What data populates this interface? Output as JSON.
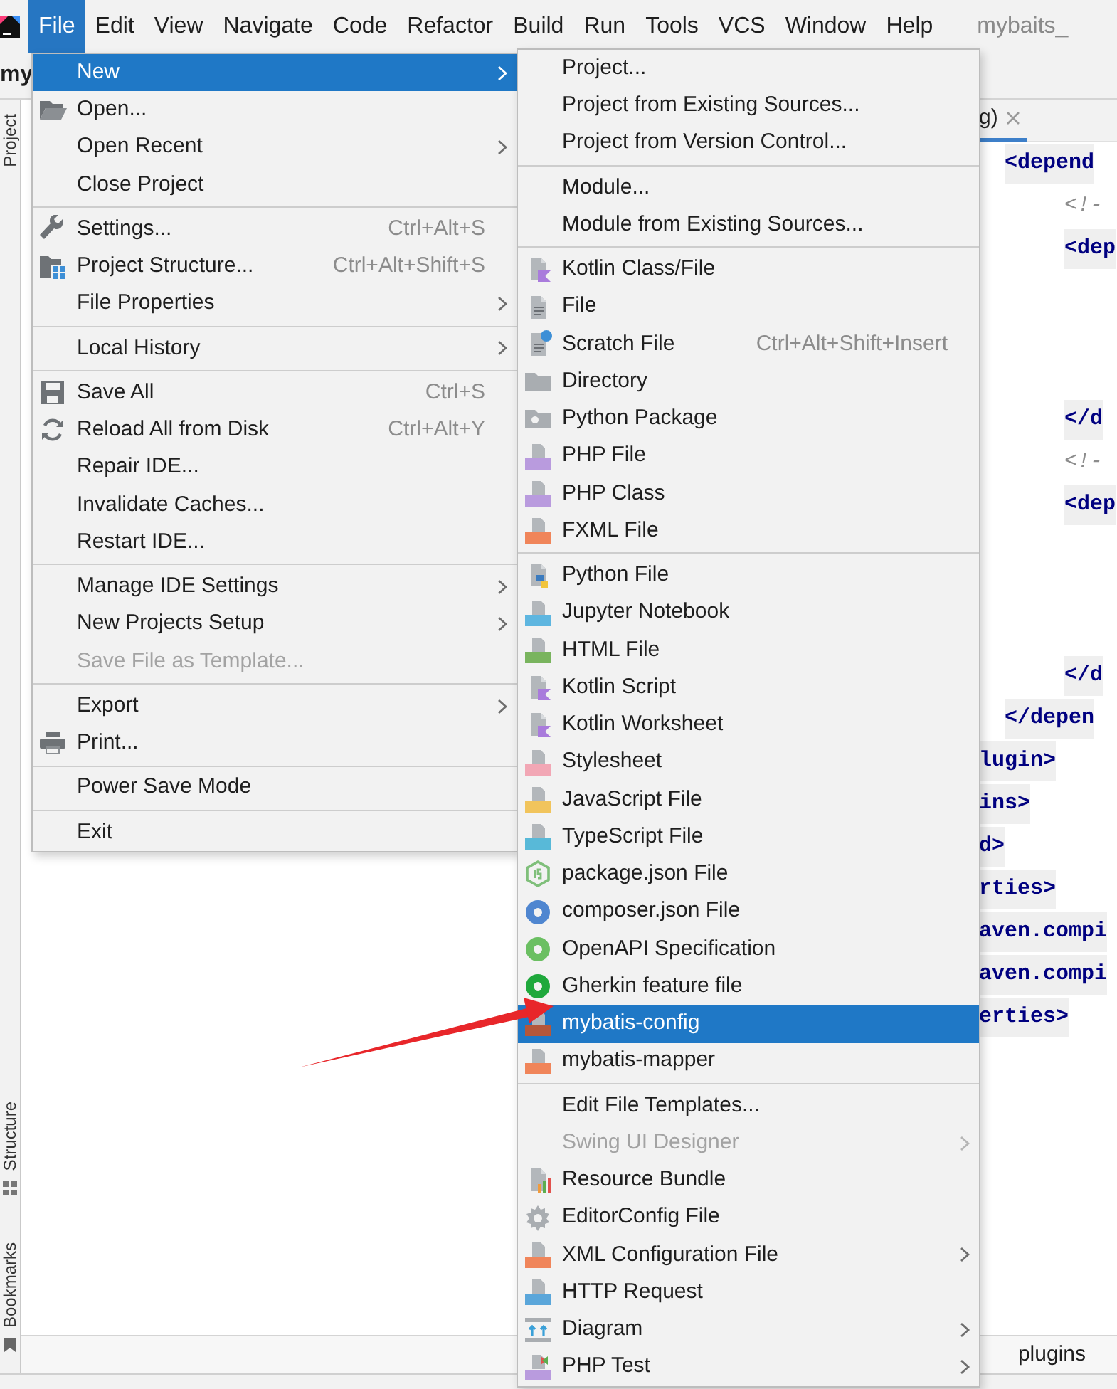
{
  "menu_bar": {
    "items": [
      {
        "label": "File",
        "selected": true
      },
      {
        "label": "Edit",
        "selected": false
      },
      {
        "label": "View",
        "selected": false
      },
      {
        "label": "Navigate",
        "selected": false
      },
      {
        "label": "Code",
        "selected": false
      },
      {
        "label": "Refactor",
        "selected": false
      },
      {
        "label": "Build",
        "selected": false
      },
      {
        "label": "Run",
        "selected": false
      },
      {
        "label": "Tools",
        "selected": false
      },
      {
        "label": "VCS",
        "selected": false
      },
      {
        "label": "Window",
        "selected": false
      },
      {
        "label": "Help",
        "selected": false
      }
    ],
    "title": "mybaits_"
  },
  "navigation_bar": {
    "project": "my"
  },
  "left_strip": {
    "top": [
      {
        "label": "Project"
      }
    ],
    "bottom": [
      {
        "label": "Structure"
      },
      {
        "label": "Bookmarks"
      }
    ]
  },
  "editor": {
    "tab": "g)",
    "lines": [
      {
        "kind": "outer",
        "text": "<depend"
      },
      {
        "kind": "comment",
        "text": "<!-"
      },
      {
        "kind": "inner",
        "text": "<dep"
      },
      {
        "kind": "blank"
      },
      {
        "kind": "blank"
      },
      {
        "kind": "blank"
      },
      {
        "kind": "inner",
        "text": "</d"
      },
      {
        "kind": "comment",
        "text": "<!-"
      },
      {
        "kind": "inner",
        "text": "<dep"
      },
      {
        "kind": "blank"
      },
      {
        "kind": "blank"
      },
      {
        "kind": "blank"
      },
      {
        "kind": "inner",
        "text": "</d"
      },
      {
        "kind": "outer",
        "text": "</depen"
      },
      {
        "kind": "cut",
        "text": "lugin>"
      },
      {
        "kind": "cut",
        "text": "ins>"
      },
      {
        "kind": "cut",
        "text": "d>"
      },
      {
        "kind": "cut",
        "text": "rties>"
      },
      {
        "kind": "cut",
        "text": "aven.compi"
      },
      {
        "kind": "cut",
        "text": "aven.compi"
      },
      {
        "kind": "cut",
        "text": "erties>"
      }
    ],
    "breadcrumb": "plugins"
  },
  "file_menu": {
    "items": [
      {
        "kind": "item",
        "label": "New",
        "selected": true,
        "disabled": false,
        "submenu": true
      },
      {
        "kind": "item",
        "label": "Open...",
        "selected": false,
        "disabled": false,
        "submenu": false
      },
      {
        "kind": "item",
        "label": "Open Recent",
        "selected": false,
        "disabled": false,
        "submenu": true
      },
      {
        "kind": "item",
        "label": "Close Project",
        "selected": false,
        "disabled": false,
        "submenu": false
      },
      {
        "kind": "separator"
      },
      {
        "kind": "item",
        "label": "Settings...",
        "shortcut": "Ctrl+Alt+S",
        "selected": false,
        "disabled": false,
        "submenu": false
      },
      {
        "kind": "item",
        "label": "Project Structure...",
        "shortcut": "Ctrl+Alt+Shift+S",
        "selected": false,
        "disabled": false,
        "submenu": false
      },
      {
        "kind": "item",
        "label": "File Properties",
        "selected": false,
        "disabled": false,
        "submenu": true
      },
      {
        "kind": "separator"
      },
      {
        "kind": "item",
        "label": "Local History",
        "selected": false,
        "disabled": false,
        "submenu": true
      },
      {
        "kind": "separator"
      },
      {
        "kind": "item",
        "label": "Save All",
        "shortcut": "Ctrl+S",
        "selected": false,
        "disabled": false,
        "submenu": false
      },
      {
        "kind": "item",
        "label": "Reload All from Disk",
        "shortcut": "Ctrl+Alt+Y",
        "selected": false,
        "disabled": false,
        "submenu": false
      },
      {
        "kind": "item",
        "label": "Repair IDE...",
        "selected": false,
        "disabled": false,
        "submenu": false
      },
      {
        "kind": "item",
        "label": "Invalidate Caches...",
        "selected": false,
        "disabled": false,
        "submenu": false
      },
      {
        "kind": "item",
        "label": "Restart IDE...",
        "selected": false,
        "disabled": false,
        "submenu": false
      },
      {
        "kind": "separator"
      },
      {
        "kind": "item",
        "label": "Manage IDE Settings",
        "selected": false,
        "disabled": false,
        "submenu": true
      },
      {
        "kind": "item",
        "label": "New Projects Setup",
        "selected": false,
        "disabled": false,
        "submenu": true
      },
      {
        "kind": "item",
        "label": "Save File as Template...",
        "selected": false,
        "disabled": true,
        "submenu": false
      },
      {
        "kind": "separator"
      },
      {
        "kind": "item",
        "label": "Export",
        "selected": false,
        "disabled": false,
        "submenu": true
      },
      {
        "kind": "item",
        "label": "Print...",
        "selected": false,
        "disabled": false,
        "submenu": false
      },
      {
        "kind": "separator"
      },
      {
        "kind": "item",
        "label": "Power Save Mode",
        "selected": false,
        "disabled": false,
        "submenu": false
      },
      {
        "kind": "separator"
      },
      {
        "kind": "item",
        "label": "Exit",
        "selected": false,
        "disabled": false,
        "submenu": false
      }
    ]
  },
  "new_menu": {
    "items": [
      {
        "kind": "item",
        "label": "Project...",
        "selected": false,
        "disabled": false,
        "submenu": false
      },
      {
        "kind": "item",
        "label": "Project from Existing Sources...",
        "selected": false,
        "disabled": false,
        "submenu": false
      },
      {
        "kind": "item",
        "label": "Project from Version Control...",
        "selected": false,
        "disabled": false,
        "submenu": false
      },
      {
        "kind": "separator"
      },
      {
        "kind": "item",
        "label": "Module...",
        "selected": false,
        "disabled": false,
        "submenu": false
      },
      {
        "kind": "item",
        "label": "Module from Existing Sources...",
        "selected": false,
        "disabled": false,
        "submenu": false
      },
      {
        "kind": "separator"
      },
      {
        "kind": "item",
        "label": "Kotlin Class/File",
        "color": "#a97bdc",
        "selected": false,
        "disabled": false,
        "submenu": false
      },
      {
        "kind": "item",
        "label": "File",
        "selected": false,
        "disabled": false,
        "submenu": false
      },
      {
        "kind": "item",
        "label": "Scratch File",
        "color": "#3d8fd6",
        "shortcut": "Ctrl+Alt+Shift+Insert",
        "selected": false,
        "disabled": false,
        "submenu": false
      },
      {
        "kind": "item",
        "label": "Directory",
        "selected": false,
        "disabled": false,
        "submenu": false
      },
      {
        "kind": "item",
        "label": "Python Package",
        "selected": false,
        "disabled": false,
        "submenu": false
      },
      {
        "kind": "item",
        "label": "PHP File",
        "color": "#b99bde",
        "selected": false,
        "disabled": false,
        "submenu": false
      },
      {
        "kind": "item",
        "label": "PHP Class",
        "color": "#b99bde",
        "selected": false,
        "disabled": false,
        "submenu": false
      },
      {
        "kind": "item",
        "label": "FXML File",
        "color": "#f0855a",
        "selected": false,
        "disabled": false,
        "submenu": false
      },
      {
        "kind": "separator"
      },
      {
        "kind": "item",
        "label": "Python File",
        "selected": false,
        "disabled": false,
        "submenu": false
      },
      {
        "kind": "item",
        "label": "Jupyter Notebook",
        "color": "#5eb6e0",
        "selected": false,
        "disabled": false,
        "submenu": false
      },
      {
        "kind": "item",
        "label": "HTML File",
        "color": "#79b45e",
        "selected": false,
        "disabled": false,
        "submenu": false
      },
      {
        "kind": "item",
        "label": "Kotlin Script",
        "color": "#a97bdc",
        "selected": false,
        "disabled": false,
        "submenu": false
      },
      {
        "kind": "item",
        "label": "Kotlin Worksheet",
        "color": "#a97bdc",
        "selected": false,
        "disabled": false,
        "submenu": false
      },
      {
        "kind": "item",
        "label": "Stylesheet",
        "color": "#f2a7b5",
        "selected": false,
        "disabled": false,
        "submenu": false
      },
      {
        "kind": "item",
        "label": "JavaScript File",
        "color": "#f1c45c",
        "selected": false,
        "disabled": false,
        "submenu": false
      },
      {
        "kind": "item",
        "label": "TypeScript File",
        "color": "#58b9d8",
        "selected": false,
        "disabled": false,
        "submenu": false
      },
      {
        "kind": "item",
        "label": "package.json File",
        "color": "#7fbf7a",
        "selected": false,
        "disabled": false,
        "submenu": false
      },
      {
        "kind": "item",
        "label": "composer.json File",
        "color": "#4f86d0",
        "selected": false,
        "disabled": false,
        "submenu": false
      },
      {
        "kind": "item",
        "label": "OpenAPI Specification",
        "color": "#6bbf62",
        "selected": false,
        "disabled": false,
        "submenu": false
      },
      {
        "kind": "item",
        "label": "Gherkin feature file",
        "color": "#1fa83c",
        "selected": false,
        "disabled": false,
        "submenu": false
      },
      {
        "kind": "item",
        "label": "mybatis-config",
        "color": "#b5573a",
        "selected": true,
        "disabled": false,
        "submenu": false
      },
      {
        "kind": "item",
        "label": "mybatis-mapper",
        "color": "#f0855a",
        "selected": false,
        "disabled": false,
        "submenu": false
      },
      {
        "kind": "separator"
      },
      {
        "kind": "item",
        "label": "Edit File Templates...",
        "selected": false,
        "disabled": false,
        "submenu": false
      },
      {
        "kind": "item",
        "label": "Swing UI Designer",
        "selected": false,
        "disabled": true,
        "submenu": true
      },
      {
        "kind": "item",
        "label": "Resource Bundle",
        "selected": false,
        "disabled": false,
        "submenu": false
      },
      {
        "kind": "item",
        "label": "EditorConfig File",
        "selected": false,
        "disabled": false,
        "submenu": false
      },
      {
        "kind": "item",
        "label": "XML Configuration File",
        "color": "#f0855a",
        "selected": false,
        "disabled": false,
        "submenu": true
      },
      {
        "kind": "item",
        "label": "HTTP Request",
        "color": "#5aa6da",
        "selected": false,
        "disabled": false,
        "submenu": false
      },
      {
        "kind": "item",
        "label": "Diagram",
        "selected": false,
        "disabled": false,
        "submenu": true
      },
      {
        "kind": "item",
        "label": "PHP Test",
        "color": "#b99bde",
        "selected": false,
        "disabled": false,
        "submenu": true
      }
    ]
  }
}
